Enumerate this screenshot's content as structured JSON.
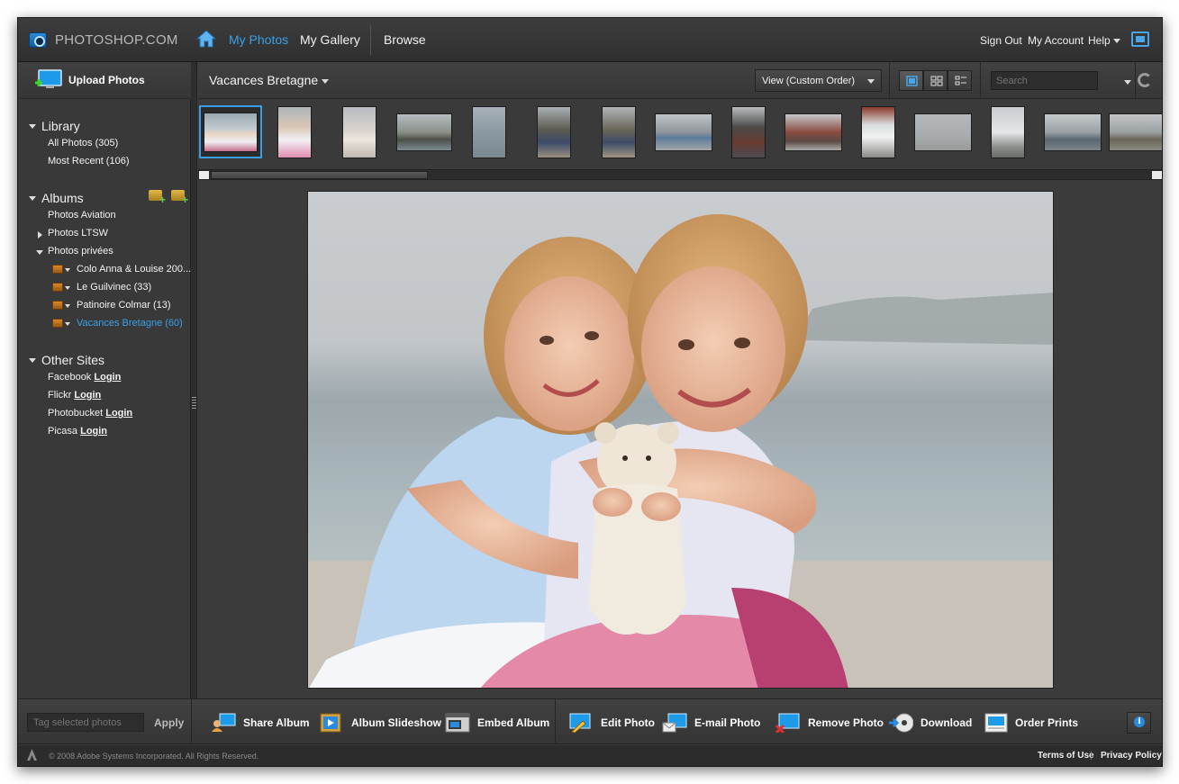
{
  "app": {
    "logo_text": "PHOTOSHOP.COM"
  },
  "nav": {
    "my_photos": "My Photos",
    "my_gallery": "My Gallery",
    "browse": "Browse"
  },
  "account": {
    "sign_out": "Sign Out",
    "my_account": "My Account",
    "help": "Help"
  },
  "sidebar": {
    "upload": "Upload Photos",
    "library": {
      "title": "Library",
      "items": [
        "All Photos (305)",
        "Most Recent (106)"
      ]
    },
    "albums": {
      "title": "Albums",
      "items": [
        "Photos Aviation",
        "Photos LTSW",
        "Photos privées"
      ],
      "sub_items": [
        "Colo Anna & Louise 200...",
        "Le Guilvinec (33)",
        "Patinoire Colmar (13)",
        "Vacances Bretagne (60)"
      ]
    },
    "other_sites": {
      "title": "Other Sites",
      "login_label": "Login",
      "items": [
        "Facebook",
        "Flickr",
        "Photobucket",
        "Picasa"
      ]
    }
  },
  "main": {
    "album_title": "Vacances Bretagne",
    "view_select": "View (Custom Order)",
    "search_placeholder": "Search"
  },
  "bottom": {
    "tag_placeholder": "Tag selected photos",
    "apply": "Apply",
    "tools": [
      "Share Album",
      "Album Slideshow",
      "Embed Album",
      "Edit Photo",
      "E-mail Photo",
      "Remove Photo",
      "Download",
      "Order Prints"
    ]
  },
  "footer": {
    "copyright": "© 2008 Adobe Systems Incorporated. All Rights Reserved.",
    "terms": "Terms of Use",
    "privacy": "Privacy Policy"
  },
  "colors": {
    "accent": "#3aa0e8",
    "background": "#3b3b3b",
    "selection": "#3a9ee6"
  },
  "icons": [
    "home-icon",
    "fullscreen-icon",
    "upload-icon",
    "folder-add-icon",
    "album-icon",
    "refresh-icon",
    "info-icon"
  ]
}
